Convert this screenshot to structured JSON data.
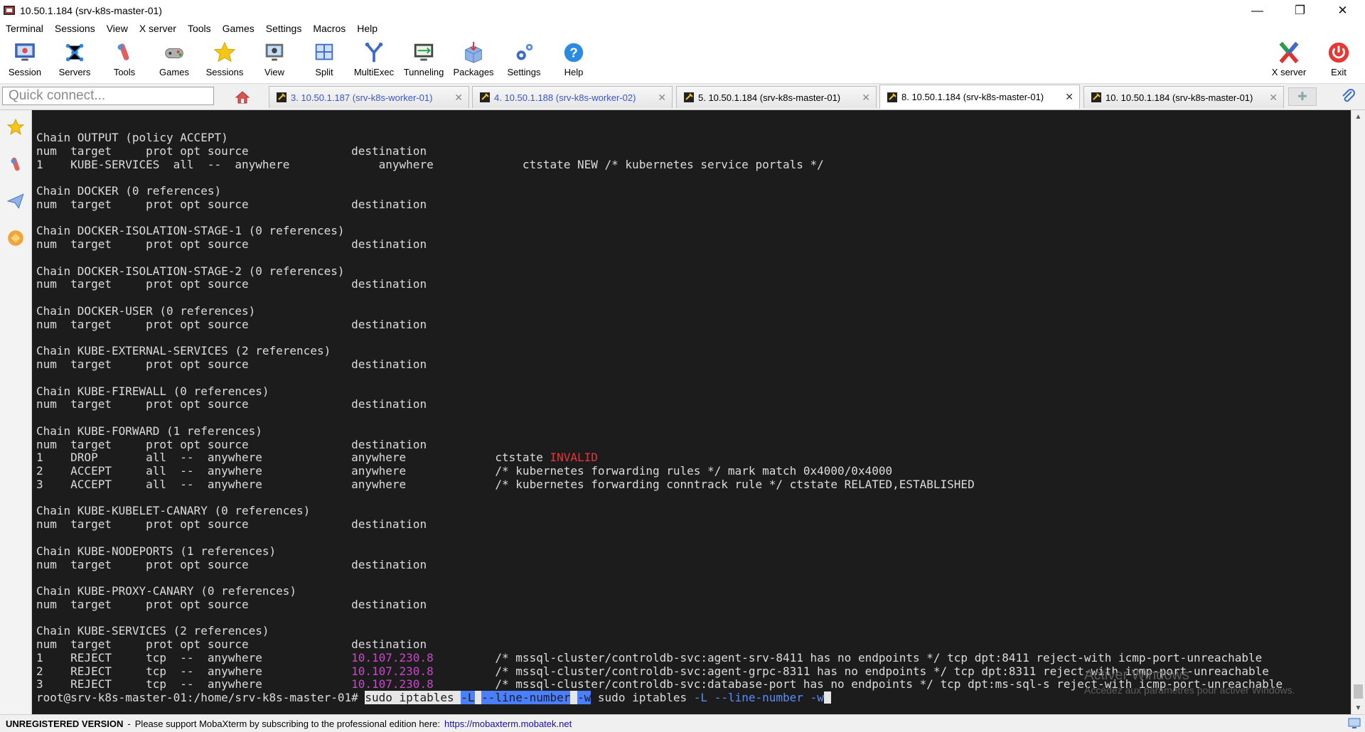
{
  "window": {
    "title": "10.50.1.184 (srv-k8s-master-01)",
    "controls": {
      "minimize": "—",
      "restore": "❐",
      "close": "✕"
    }
  },
  "menu": [
    "Terminal",
    "Sessions",
    "View",
    "X server",
    "Tools",
    "Games",
    "Settings",
    "Macros",
    "Help"
  ],
  "toolbar": {
    "left": [
      {
        "label": "Session",
        "icon": "monitor-session-icon"
      },
      {
        "label": "Servers",
        "icon": "servers-icon"
      },
      {
        "label": "Tools",
        "icon": "tools-icon"
      },
      {
        "label": "Games",
        "icon": "games-icon"
      },
      {
        "label": "Sessions",
        "icon": "star-sessions-icon"
      },
      {
        "label": "View",
        "icon": "view-icon"
      },
      {
        "label": "Split",
        "icon": "split-icon"
      },
      {
        "label": "MultiExec",
        "icon": "multiexec-icon"
      },
      {
        "label": "Tunneling",
        "icon": "tunneling-icon"
      },
      {
        "label": "Packages",
        "icon": "packages-icon"
      },
      {
        "label": "Settings",
        "icon": "gears-icon"
      },
      {
        "label": "Help",
        "icon": "help-icon"
      }
    ],
    "right": [
      {
        "label": "X server",
        "icon": "xserver-icon"
      },
      {
        "label": "Exit",
        "icon": "power-icon"
      }
    ]
  },
  "quick_connect": {
    "placeholder": "Quick connect..."
  },
  "tabs": [
    {
      "label": "3. 10.50.1.187 (srv-k8s-worker-01)",
      "active": false,
      "color": "#3a56c8"
    },
    {
      "label": "4. 10.50.1.188 (srv-k8s-worker-02)",
      "active": false,
      "color": "#3a56c8"
    },
    {
      "label": "5. 10.50.1.184 (srv-k8s-master-01)",
      "active": false,
      "color": "#000000"
    },
    {
      "label": "8. 10.50.1.184 (srv-k8s-master-01)",
      "active": true,
      "color": "#000000"
    },
    {
      "label": "10. 10.50.1.184 (srv-k8s-master-01)",
      "active": false,
      "color": "#000000"
    }
  ],
  "terminal": {
    "lines": [
      [
        {
          "t": "Chain OUTPUT (policy ACCEPT)"
        }
      ],
      [
        {
          "t": "num  target     prot opt source               destination"
        }
      ],
      [
        {
          "t": "1    KUBE-SERVICES  all  --  anywhere             anywhere             ctstate NEW /* kubernetes service portals */"
        }
      ],
      [
        {
          "t": ""
        }
      ],
      [
        {
          "t": "Chain DOCKER (0 references)"
        }
      ],
      [
        {
          "t": "num  target     prot opt source               destination"
        }
      ],
      [
        {
          "t": ""
        }
      ],
      [
        {
          "t": "Chain DOCKER-ISOLATION-STAGE-1 (0 references)"
        }
      ],
      [
        {
          "t": "num  target     prot opt source               destination"
        }
      ],
      [
        {
          "t": ""
        }
      ],
      [
        {
          "t": "Chain DOCKER-ISOLATION-STAGE-2 (0 references)"
        }
      ],
      [
        {
          "t": "num  target     prot opt source               destination"
        }
      ],
      [
        {
          "t": ""
        }
      ],
      [
        {
          "t": "Chain DOCKER-USER (0 references)"
        }
      ],
      [
        {
          "t": "num  target     prot opt source               destination"
        }
      ],
      [
        {
          "t": ""
        }
      ],
      [
        {
          "t": "Chain KUBE-EXTERNAL-SERVICES (2 references)"
        }
      ],
      [
        {
          "t": "num  target     prot opt source               destination"
        }
      ],
      [
        {
          "t": ""
        }
      ],
      [
        {
          "t": "Chain KUBE-FIREWALL (0 references)"
        }
      ],
      [
        {
          "t": "num  target     prot opt source               destination"
        }
      ],
      [
        {
          "t": ""
        }
      ],
      [
        {
          "t": "Chain KUBE-FORWARD (1 references)"
        }
      ],
      [
        {
          "t": "num  target     prot opt source               destination"
        }
      ],
      [
        {
          "t": "1    DROP       all  --  anywhere             anywhere             ctstate "
        },
        {
          "t": "INVALID",
          "c": "c-red"
        }
      ],
      [
        {
          "t": "2    ACCEPT     all  --  anywhere             anywhere             /* kubernetes forwarding rules */ mark match 0x4000/0x4000"
        }
      ],
      [
        {
          "t": "3    ACCEPT     all  --  anywhere             anywhere             /* kubernetes forwarding conntrack rule */ ctstate RELATED,ESTABLISHED"
        }
      ],
      [
        {
          "t": ""
        }
      ],
      [
        {
          "t": "Chain KUBE-KUBELET-CANARY (0 references)"
        }
      ],
      [
        {
          "t": "num  target     prot opt source               destination"
        }
      ],
      [
        {
          "t": ""
        }
      ],
      [
        {
          "t": "Chain KUBE-NODEPORTS (1 references)"
        }
      ],
      [
        {
          "t": "num  target     prot opt source               destination"
        }
      ],
      [
        {
          "t": ""
        }
      ],
      [
        {
          "t": "Chain KUBE-PROXY-CANARY (0 references)"
        }
      ],
      [
        {
          "t": "num  target     prot opt source               destination"
        }
      ],
      [
        {
          "t": ""
        }
      ],
      [
        {
          "t": "Chain KUBE-SERVICES (2 references)"
        }
      ],
      [
        {
          "t": "num  target     prot opt source               destination"
        }
      ],
      [
        {
          "t": "1    REJECT     tcp  --  anywhere             "
        },
        {
          "t": "10.107.230.8",
          "c": "c-mag"
        },
        {
          "t": "         /* mssql-cluster/controldb-svc:agent-srv-8411 has no endpoints */ tcp dpt:8411 reject-with icmp-port-unreachable"
        }
      ],
      [
        {
          "t": "2    REJECT     tcp  --  anywhere             "
        },
        {
          "t": "10.107.230.8",
          "c": "c-mag"
        },
        {
          "t": "         /* mssql-cluster/controldb-svc:agent-grpc-8311 has no endpoints */ tcp dpt:8311 reject-with icmp-port-unreachable"
        }
      ],
      [
        {
          "t": "3    REJECT     tcp  --  anywhere             "
        },
        {
          "t": "10.107.230.8",
          "c": "c-mag"
        },
        {
          "t": "         /* mssql-cluster/controldb-svc:database-port has no endpoints */ tcp dpt:ms-sql-s reject-with icmp-port-unreachable"
        }
      ],
      [
        {
          "t": "root@srv-k8s-master-01:/home/srv-k8s-master-01# "
        },
        {
          "t": "sudo iptables ",
          "c": "c-hl"
        },
        {
          "t": "-L",
          "c": "c-hlb"
        },
        {
          "t": " ",
          "c": "c-hl"
        },
        {
          "t": "--line-number",
          "c": "c-hlb"
        },
        {
          "t": " ",
          "c": "c-hl"
        },
        {
          "t": "-w",
          "c": "c-hlb"
        },
        {
          "t": " sudo iptables "
        },
        {
          "t": "-L",
          "c": "c-blue"
        },
        {
          "t": " "
        },
        {
          "t": "--line-number",
          "c": "c-blue"
        },
        {
          "t": " "
        },
        {
          "t": "-w",
          "c": "c-blue"
        },
        {
          "cursor": true
        }
      ]
    ],
    "watermark": {
      "line1": "Activer Windows",
      "line2": "Accédez aux paramètres pour activer Windows."
    }
  },
  "statusbar": {
    "version": "UNREGISTERED VERSION",
    "separator": "-",
    "message": "Please support MobaXterm by subscribing to the professional edition here:",
    "link": "https://mobaxterm.mobatek.net"
  }
}
